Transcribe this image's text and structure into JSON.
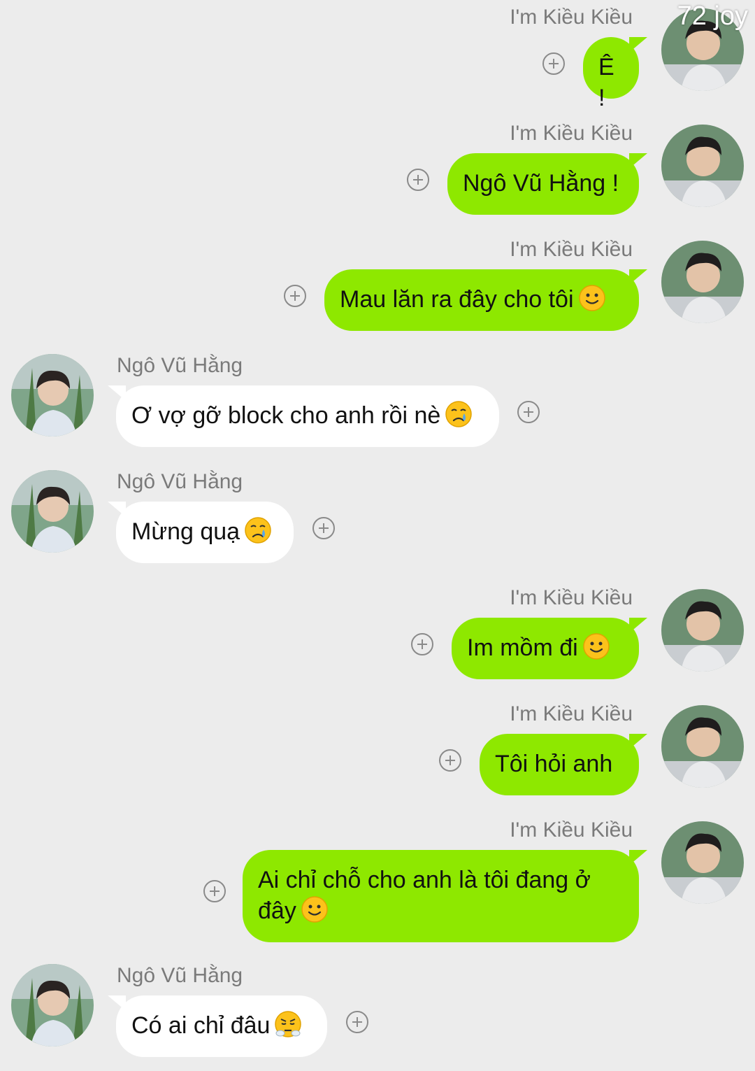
{
  "watermark": "72 joy",
  "colors": {
    "background": "#ececec",
    "sent_bubble": "#8ee800",
    "received_bubble": "#ffffff",
    "sender_name": "#7a7a7a"
  },
  "messages": [
    {
      "side": "right",
      "sender": "I'm Kiều Kiều",
      "text": "Ê !",
      "emoji": ""
    },
    {
      "side": "right",
      "sender": "I'm Kiều Kiều",
      "text": "Ngô Vũ Hằng !",
      "emoji": ""
    },
    {
      "side": "right",
      "sender": "I'm Kiều Kiều",
      "text": "Mau lăn ra đây cho tôi",
      "emoji": "smile-emoji"
    },
    {
      "side": "left",
      "sender": "Ngô Vũ Hằng",
      "text": "Ơ vợ gỡ block cho anh rồi nè",
      "emoji": "crying-emoji"
    },
    {
      "side": "left",
      "sender": "Ngô Vũ Hằng",
      "text": "Mừng quạ",
      "emoji": "crying-emoji"
    },
    {
      "side": "right",
      "sender": "I'm Kiều Kiều",
      "text": "Im mồm đi",
      "emoji": "smile-emoji"
    },
    {
      "side": "right",
      "sender": "I'm Kiều Kiều",
      "text": "Tôi hỏi anh",
      "emoji": ""
    },
    {
      "side": "right",
      "sender": "I'm Kiều Kiều",
      "text": "Ai chỉ chỗ cho anh là tôi đang ở đây",
      "emoji": "smile-emoji"
    },
    {
      "side": "left",
      "sender": "Ngô Vũ Hằng",
      "text": "Có ai chỉ đâu",
      "emoji": "huffing-emoji"
    }
  ]
}
